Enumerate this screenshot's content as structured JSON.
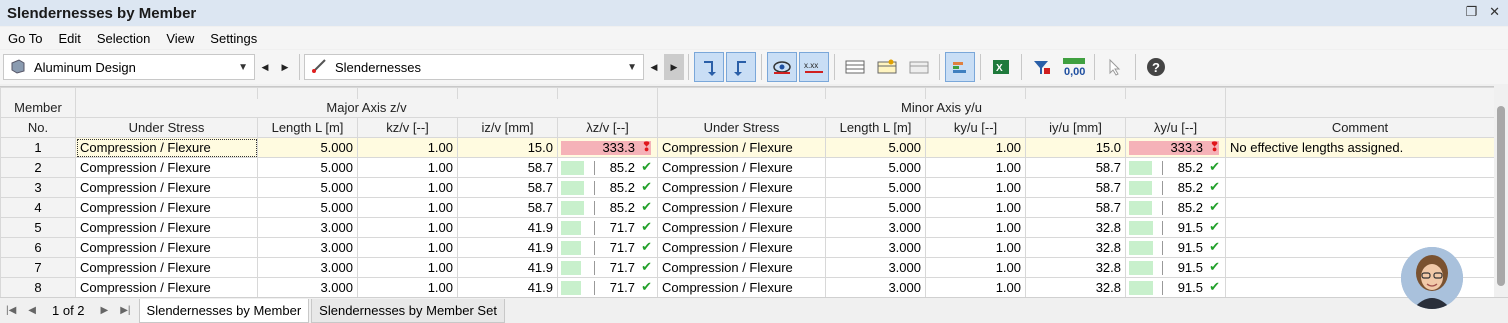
{
  "window": {
    "title": "Slendernesses by Member"
  },
  "menu": [
    "Go To",
    "Edit",
    "Selection",
    "View",
    "Settings"
  ],
  "toolbar": {
    "module": "Aluminum Design",
    "result": "Slendernesses"
  },
  "table": {
    "group_major": "Major Axis z/v",
    "group_minor": "Minor Axis y/u",
    "col_member": [
      "Member",
      "No."
    ],
    "headers_major": [
      "Under Stress",
      "Length L [m]",
      "kz/v [--]",
      "iz/v [mm]",
      "λz/v [--]"
    ],
    "headers_minor": [
      "Under Stress",
      "Length L [m]",
      "ky/u [--]",
      "iy/u [mm]",
      "λy/u [--]"
    ],
    "col_comment": "Comment",
    "rows": [
      {
        "no": "1",
        "ms": "Compression / Flexure",
        "mL": "5.000",
        "mk": "1.00",
        "mi": "15.0",
        "ml": "333.3",
        "mlf": 1.0,
        "mls": "err",
        "ns": "Compression / Flexure",
        "nL": "5.000",
        "nk": "1.00",
        "ni": "15.0",
        "nl": "333.3",
        "nlf": 1.0,
        "nls": "err",
        "comment": "No effective lengths assigned."
      },
      {
        "no": "2",
        "ms": "Compression / Flexure",
        "mL": "5.000",
        "mk": "1.00",
        "mi": "58.7",
        "ml": "85.2",
        "mlf": 0.26,
        "mls": "ok",
        "ns": "Compression / Flexure",
        "nL": "5.000",
        "nk": "1.00",
        "ni": "58.7",
        "nl": "85.2",
        "nlf": 0.26,
        "nls": "ok",
        "comment": ""
      },
      {
        "no": "3",
        "ms": "Compression / Flexure",
        "mL": "5.000",
        "mk": "1.00",
        "mi": "58.7",
        "ml": "85.2",
        "mlf": 0.26,
        "mls": "ok",
        "ns": "Compression / Flexure",
        "nL": "5.000",
        "nk": "1.00",
        "ni": "58.7",
        "nl": "85.2",
        "nlf": 0.26,
        "nls": "ok",
        "comment": ""
      },
      {
        "no": "4",
        "ms": "Compression / Flexure",
        "mL": "5.000",
        "mk": "1.00",
        "mi": "58.7",
        "ml": "85.2",
        "mlf": 0.26,
        "mls": "ok",
        "ns": "Compression / Flexure",
        "nL": "5.000",
        "nk": "1.00",
        "ni": "58.7",
        "nl": "85.2",
        "nlf": 0.26,
        "nls": "ok",
        "comment": ""
      },
      {
        "no": "5",
        "ms": "Compression / Flexure",
        "mL": "3.000",
        "mk": "1.00",
        "mi": "41.9",
        "ml": "71.7",
        "mlf": 0.22,
        "mls": "ok",
        "ns": "Compression / Flexure",
        "nL": "3.000",
        "nk": "1.00",
        "ni": "32.8",
        "nl": "91.5",
        "nlf": 0.27,
        "nls": "ok",
        "comment": ""
      },
      {
        "no": "6",
        "ms": "Compression / Flexure",
        "mL": "3.000",
        "mk": "1.00",
        "mi": "41.9",
        "ml": "71.7",
        "mlf": 0.22,
        "mls": "ok",
        "ns": "Compression / Flexure",
        "nL": "3.000",
        "nk": "1.00",
        "ni": "32.8",
        "nl": "91.5",
        "nlf": 0.27,
        "nls": "ok",
        "comment": ""
      },
      {
        "no": "7",
        "ms": "Compression / Flexure",
        "mL": "3.000",
        "mk": "1.00",
        "mi": "41.9",
        "ml": "71.7",
        "mlf": 0.22,
        "mls": "ok",
        "ns": "Compression / Flexure",
        "nL": "3.000",
        "nk": "1.00",
        "ni": "32.8",
        "nl": "91.5",
        "nlf": 0.27,
        "nls": "ok",
        "comment": ""
      },
      {
        "no": "8",
        "ms": "Compression / Flexure",
        "mL": "3.000",
        "mk": "1.00",
        "mi": "41.9",
        "ml": "71.7",
        "mlf": 0.22,
        "mls": "ok",
        "ns": "Compression / Flexure",
        "nL": "3.000",
        "nk": "1.00",
        "ni": "32.8",
        "nl": "91.5",
        "nlf": 0.27,
        "nls": "ok",
        "comment": ""
      }
    ]
  },
  "status": {
    "page": "1 of 2",
    "tabs": [
      "Slendernesses by Member",
      "Slendernesses by Member Set"
    ]
  },
  "colors": {
    "ok": "#22a02a",
    "error": "#e0161b",
    "bar_ok": "#c8f0cc",
    "bar_error": "#f5b2b8",
    "selected_row": "#fffbe0"
  }
}
